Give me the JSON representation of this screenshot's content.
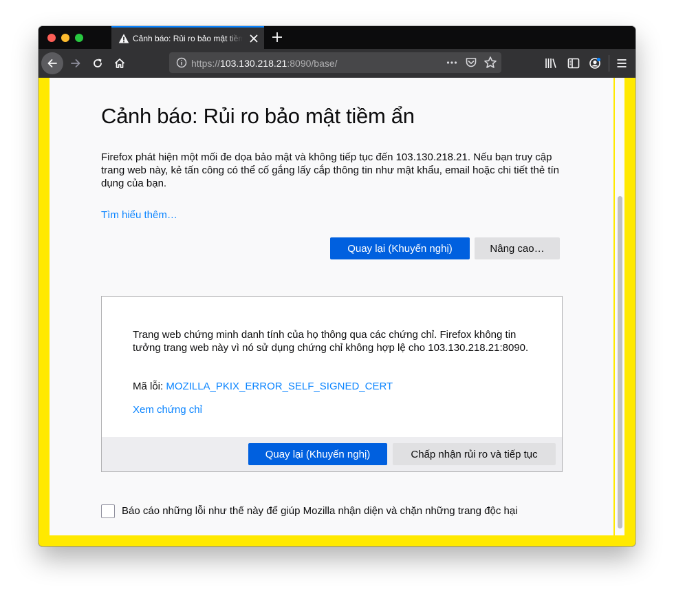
{
  "tab": {
    "title": "Cảnh báo: Rủi ro bảo mật tiềm ẩn"
  },
  "urlbar": {
    "prefix": "https://",
    "host": "103.130.218.21",
    "suffix": ":8090/base/"
  },
  "page": {
    "heading": "Cảnh báo: Rủi ro bảo mật tiềm ẩn",
    "intro": "Firefox phát hiện một mối đe dọa bảo mật và không tiếp tục đến 103.130.218.21. Nếu bạn truy cập trang web này, kẻ tấn công có thể cố gắng lấy cắp thông tin như mật khẩu, email hoặc chi tiết thẻ tín dụng của bạn.",
    "learn_more": "Tìm hiểu thêm…",
    "go_back_label": "Quay lại (Khuyến nghị)",
    "advanced_label": "Nâng cao…",
    "report_label": "Báo cáo những lỗi như thế này để giúp Mozilla nhận diện và chặn những trang độc hại"
  },
  "advanced": {
    "description": "Trang web chứng minh danh tính của họ thông qua các chứng chỉ. Firefox không tin tưởng trang web này vì nó sử dụng chứng chỉ không hợp lệ cho 103.130.218.21:8090.",
    "error_prefix": "Mã lỗi: ",
    "error_code": "MOZILLA_PKIX_ERROR_SELF_SIGNED_CERT",
    "view_cert": "Xem chứng chỉ",
    "go_back_label": "Quay lại (Khuyến nghị)",
    "accept_label": "Chấp nhận rủi ro và tiếp tục"
  },
  "colors": {
    "accent": "#0060df",
    "link": "#0a84ff",
    "warning_frame": "#ffe900"
  },
  "icons": [
    "warning-icon",
    "close-icon",
    "plus-icon",
    "back-arrow-icon",
    "forward-arrow-icon",
    "reload-icon",
    "home-icon",
    "info-icon",
    "more-icon",
    "pocket-icon",
    "star-icon",
    "library-icon",
    "sidebar-icon",
    "account-icon",
    "menu-icon"
  ]
}
